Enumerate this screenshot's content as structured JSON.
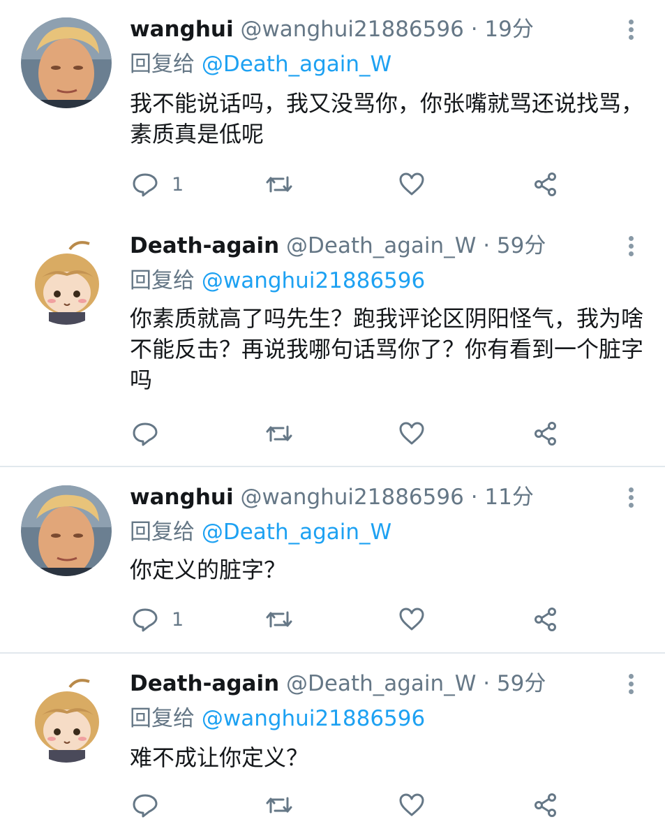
{
  "tweets": [
    {
      "name": "wanghui",
      "handle": "@wanghui21886596",
      "time": "19分",
      "reply_label": "回复给",
      "reply_to": "@Death_again_W",
      "text": "我不能说话吗，我又没骂你，你张嘴就骂还说找骂，素质真是低呢",
      "reply_count": "1",
      "avatar": "man-portrait"
    },
    {
      "name": "Death-again",
      "handle": "@Death_again_W",
      "time": "59分",
      "reply_label": "回复给",
      "reply_to": "@wanghui21886596",
      "text": "你素质就高了吗先生？跑我评论区阴阳怪气，我为啥不能反击？再说我哪句话骂你了？你有看到一个脏字吗",
      "reply_count": "",
      "avatar": "anime-girl"
    },
    {
      "name": "wanghui",
      "handle": "@wanghui21886596",
      "time": "11分",
      "reply_label": "回复给",
      "reply_to": "@Death_again_W",
      "text": "你定义的脏字？",
      "reply_count": "1",
      "avatar": "man-portrait"
    },
    {
      "name": "Death-again",
      "handle": "@Death_again_W",
      "time": "59分",
      "reply_label": "回复给",
      "reply_to": "@wanghui21886596",
      "text": "难不成让你定义？",
      "reply_count": "",
      "avatar": "anime-girl"
    }
  ],
  "separator": "·",
  "icons": {
    "reply": "reply-icon",
    "retweet": "retweet-icon",
    "like": "like-icon",
    "share": "share-icon",
    "more": "more-vertical-icon"
  },
  "colors": {
    "text": "#14171a",
    "muted": "#657786",
    "link": "#1da1f2",
    "icon": "#657786",
    "divider": "#e1e8ed"
  }
}
